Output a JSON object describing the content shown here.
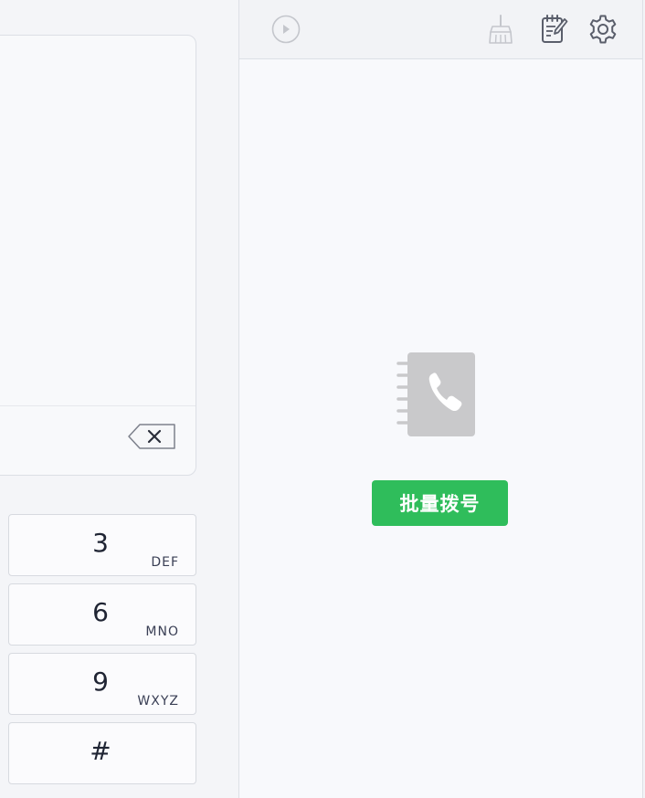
{
  "dialer": {
    "keys": [
      {
        "digit": "3",
        "letters": "DEF"
      },
      {
        "digit": "6",
        "letters": "MNO"
      },
      {
        "digit": "9",
        "letters": "WXYZ"
      },
      {
        "digit": "#",
        "letters": ""
      }
    ],
    "backspace_icon": "backspace-icon"
  },
  "toolbar": {
    "icons": [
      "play-icon",
      "broom-icon",
      "notepad-icon",
      "gear-icon"
    ]
  },
  "empty_state": {
    "icon": "contacts-book-icon",
    "batch_dial_label": "批量拨号"
  },
  "colors": {
    "accent_green": "#2fbd5b",
    "icon_gray": "#c9c9cb",
    "panel_bg": "#f8f9fc"
  }
}
